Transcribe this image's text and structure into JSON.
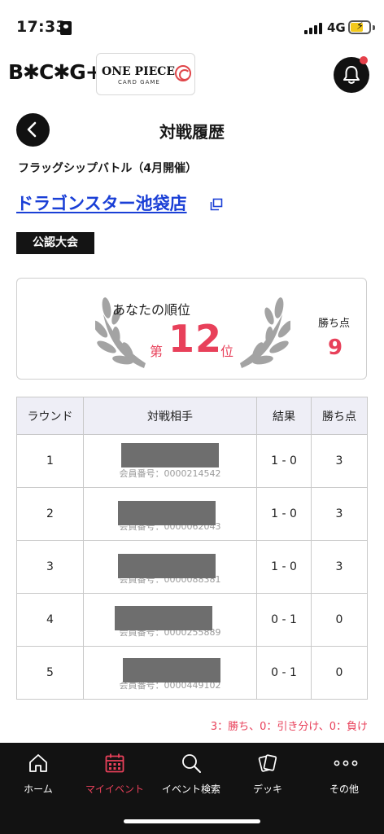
{
  "status_bar": {
    "time": "17:33",
    "network": "4G"
  },
  "header": {
    "brand": "B✱C✱G+",
    "game_logo_title": "ONE PIECE",
    "game_logo_subtitle": "CARD GAME"
  },
  "page": {
    "title": "対戦履歴",
    "event_name": "フラッグシップバトル（4月開催）",
    "shop_name": "ドラゴンスター池袋店",
    "badge": "公認大会"
  },
  "rank": {
    "label": "あなたの順位",
    "prefix": "第",
    "value": "12",
    "suffix": "位",
    "points_label": "勝ち点",
    "points_value": "9"
  },
  "table": {
    "headers": [
      "ラウンド",
      "対戦相手",
      "結果",
      "勝ち点"
    ],
    "rows": [
      {
        "round": "1",
        "member_no": "会員番号：0000214542",
        "result": "1 - 0",
        "points": "3"
      },
      {
        "round": "2",
        "member_no": "会員番号：0000062043",
        "result": "1 - 0",
        "points": "3"
      },
      {
        "round": "3",
        "member_no": "会員番号：0000088381",
        "result": "1 - 0",
        "points": "3"
      },
      {
        "round": "4",
        "member_no": "会員番号：0000255889",
        "result": "0 - 1",
        "points": "0"
      },
      {
        "round": "5",
        "member_no": "会員番号：0000449102",
        "result": "0 - 1",
        "points": "0"
      }
    ]
  },
  "legend": "3：勝ち、0：引き分け、0：負け",
  "nav": {
    "items": [
      {
        "label": "ホーム",
        "icon": "home-icon"
      },
      {
        "label": "マイイベント",
        "icon": "calendar-icon"
      },
      {
        "label": "イベント検索",
        "icon": "search-icon"
      },
      {
        "label": "デッキ",
        "icon": "cards-icon"
      },
      {
        "label": "その他",
        "icon": "more-icon"
      }
    ],
    "active_index": 1
  },
  "colors": {
    "accent": "#e8405a",
    "link": "#1a3fd6",
    "nav_bg": "#121212"
  }
}
